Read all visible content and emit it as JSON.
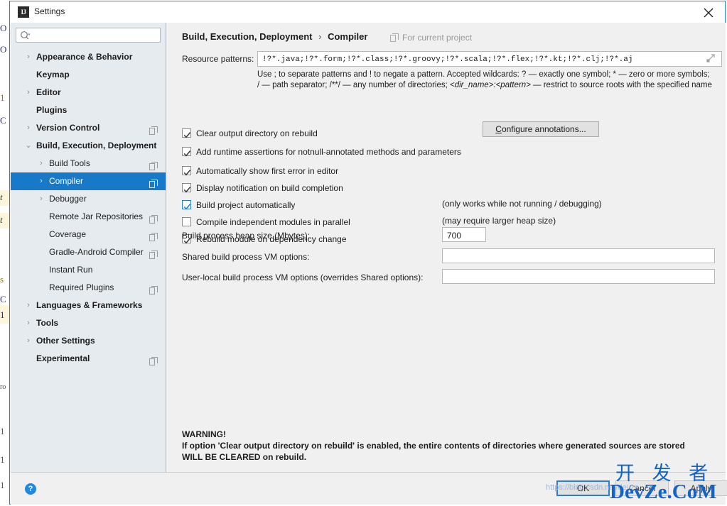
{
  "window": {
    "title": "Settings",
    "icon": "intellij-logo-icon",
    "close_label": "close-icon"
  },
  "sidebar": {
    "search": {
      "value": "",
      "placeholder": ""
    },
    "items": [
      {
        "label": "Appearance & Behavior",
        "level": 0,
        "arrow": "›",
        "scope": false,
        "selected": false
      },
      {
        "label": "Keymap",
        "level": 0,
        "arrow": "",
        "scope": false,
        "selected": false
      },
      {
        "label": "Editor",
        "level": 0,
        "arrow": "›",
        "scope": false,
        "selected": false
      },
      {
        "label": "Plugins",
        "level": 0,
        "arrow": "",
        "scope": false,
        "selected": false
      },
      {
        "label": "Version Control",
        "level": 0,
        "arrow": "›",
        "scope": true,
        "selected": false
      },
      {
        "label": "Build, Execution, Deployment",
        "level": 0,
        "arrow": "⌄",
        "scope": false,
        "selected": false
      },
      {
        "label": "Build Tools",
        "level": 1,
        "arrow": "›",
        "scope": true,
        "selected": false
      },
      {
        "label": "Compiler",
        "level": 1,
        "arrow": "›",
        "scope": true,
        "selected": true
      },
      {
        "label": "Debugger",
        "level": 1,
        "arrow": "›",
        "scope": false,
        "selected": false
      },
      {
        "label": "Remote Jar Repositories",
        "level": 1,
        "arrow": "",
        "scope": true,
        "selected": false
      },
      {
        "label": "Coverage",
        "level": 1,
        "arrow": "",
        "scope": true,
        "selected": false
      },
      {
        "label": "Gradle-Android Compiler",
        "level": 1,
        "arrow": "",
        "scope": true,
        "selected": false
      },
      {
        "label": "Instant Run",
        "level": 1,
        "arrow": "",
        "scope": false,
        "selected": false
      },
      {
        "label": "Required Plugins",
        "level": 1,
        "arrow": "",
        "scope": true,
        "selected": false
      },
      {
        "label": "Languages & Frameworks",
        "level": 0,
        "arrow": "›",
        "scope": false,
        "selected": false
      },
      {
        "label": "Tools",
        "level": 0,
        "arrow": "›",
        "scope": false,
        "selected": false
      },
      {
        "label": "Other Settings",
        "level": 0,
        "arrow": "›",
        "scope": false,
        "selected": false
      },
      {
        "label": "Experimental",
        "level": 0,
        "arrow": "",
        "scope": true,
        "selected": false
      }
    ]
  },
  "content": {
    "breadcrumb_root": "Build, Execution, Deployment",
    "breadcrumb_sep": "›",
    "breadcrumb_leaf": "Compiler",
    "for_current_project": "For current project",
    "resource_patterns_label": "Resource patterns:",
    "resource_patterns_value": "!?*.java;!?*.form;!?*.class;!?*.groovy;!?*.scala;!?*.flex;!?*.kt;!?*.clj;!?*.aj",
    "resource_patterns_placeholder": "",
    "resource_patterns_help_1": "Use ; to separate patterns and ! to negate a pattern. Accepted wildcards: ? — exactly one symbol; * — zero or more symbols; / — path separator; /**/ — any number of directories; ",
    "resource_patterns_help_dir": "<dir_name>:<pattern>",
    "resource_patterns_help_2": " — restrict to source roots with the specified name",
    "expand_icon": "expand-icon",
    "checkboxes": [
      {
        "label": "Clear output directory on rebuild",
        "checked": true,
        "focused": false,
        "note": ""
      },
      {
        "label": "Add runtime assertions for notnull-annotated methods and parameters",
        "checked": true,
        "focused": false,
        "note": ""
      },
      {
        "label": "Automatically show first error in editor",
        "checked": true,
        "focused": false,
        "note": ""
      },
      {
        "label": "Display notification on build completion",
        "checked": true,
        "focused": false,
        "note": ""
      },
      {
        "label": "Build project automatically",
        "checked": true,
        "focused": true,
        "note": "(only works while not running / debugging)"
      },
      {
        "label": "Compile independent modules in parallel",
        "checked": false,
        "focused": false,
        "note": "(may require larger heap size)"
      },
      {
        "label": "Rebuild module on dependency change",
        "checked": true,
        "focused": false,
        "note": ""
      }
    ],
    "configure_annotations_label": "Configure annotations...",
    "heap_label": "Build process heap size (Mbytes):",
    "heap_value": "700",
    "shared_vm_label": "Shared build process VM options:",
    "shared_vm_value": "",
    "userlocal_vm_label": "User-local build process VM options (overrides Shared options):",
    "userlocal_vm_value": "",
    "warning_title": "WARNING!",
    "warning_body": "If option 'Clear output directory on rebuild' is enabled, the entire contents of directories where generated sources are stored WILL BE CLEARED on rebuild."
  },
  "footer": {
    "help_label": "?",
    "ok_label": "OK",
    "cancel_label": "Cancel",
    "apply_label": "Apply"
  },
  "watermark": {
    "chinese": "开 发 者",
    "english": "DevZe.CoM",
    "url": "https://blog.csdn.net/devze"
  },
  "colors": {
    "accent": "#1879c8",
    "dialog_border": "#2a7fd4",
    "sidebar_bg": "#e6ebef",
    "content_bg": "#f0f0f0",
    "watermark": "#1464c8"
  }
}
